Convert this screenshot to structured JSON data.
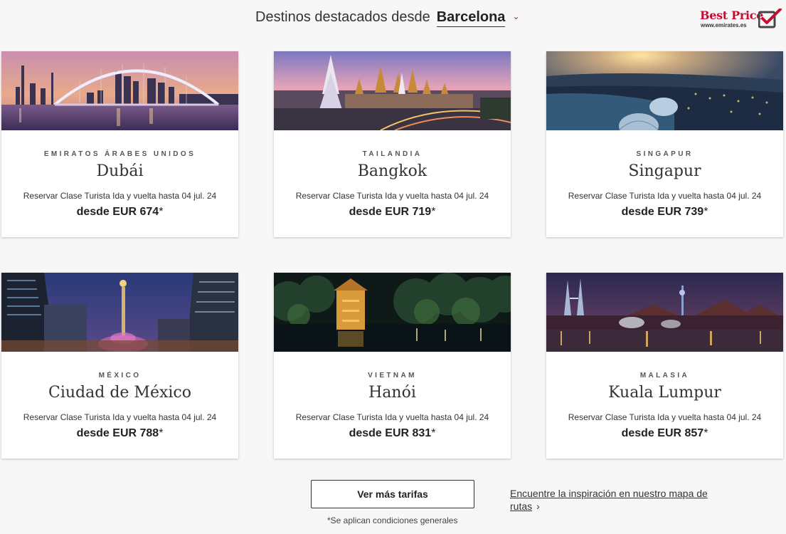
{
  "header": {
    "title": "Destinos destacados desde",
    "origin_city": "Barcelona",
    "dropdown_icon": "chevron-down-icon",
    "logo_text": "Best Price",
    "logo_sub": "www.emirates.es",
    "accent_color": "#c60c30"
  },
  "destinations": [
    {
      "country": "EMIRATOS ÁRABES UNIDOS",
      "city": "Dubái",
      "desc": "Reservar Clase Turista Ida y vuelta hasta 04 jul. 24",
      "price": "desde EUR 674",
      "asterisk": "*"
    },
    {
      "country": "TAILANDIA",
      "city": "Bangkok",
      "desc": "Reservar Clase Turista Ida y vuelta hasta 04 jul. 24",
      "price": "desde EUR 719",
      "asterisk": "*"
    },
    {
      "country": "SINGAPUR",
      "city": "Singapur",
      "desc": "Reservar Clase Turista Ida y vuelta hasta 04 jul. 24",
      "price": "desde EUR 739",
      "asterisk": "*"
    },
    {
      "country": "MÉXICO",
      "city": "Ciudad de México",
      "desc": "Reservar Clase Turista Ida y vuelta hasta 04 jul. 24",
      "price": "desde EUR 788",
      "asterisk": "*"
    },
    {
      "country": "VIETNAM",
      "city": "Hanói",
      "desc": "Reservar Clase Turista Ida y vuelta hasta 04 jul. 24",
      "price": "desde EUR 831",
      "asterisk": "*"
    },
    {
      "country": "MALASIA",
      "city": "Kuala Lumpur",
      "desc": "Reservar Clase Turista Ida y vuelta hasta 04 jul. 24",
      "price": "desde EUR 857",
      "asterisk": "*"
    }
  ],
  "footer": {
    "more_button": "Ver más tarifas",
    "conditions": "*Se aplican condiciones generales",
    "map_link": "Encuentre la inspiración en nuestro mapa de rutas"
  }
}
